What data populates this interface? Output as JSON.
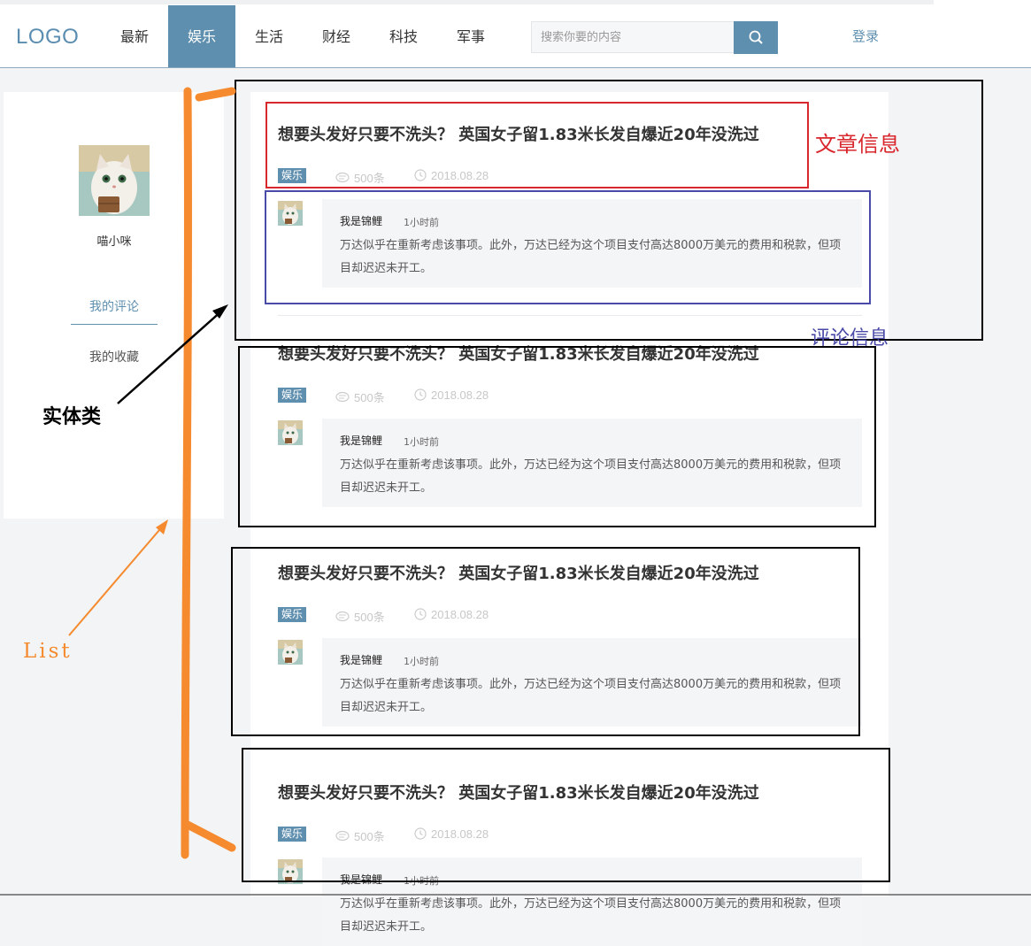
{
  "header": {
    "logo": "LOGO",
    "nav": [
      "最新",
      "娱乐",
      "生活",
      "财经",
      "科技",
      "军事"
    ],
    "active_nav": "娱乐",
    "search_placeholder": "搜索你要的内容",
    "login": "登录"
  },
  "sidebar": {
    "username": "喵小咪",
    "menu": [
      "我的评论",
      "我的收藏"
    ]
  },
  "articles": [
    {
      "title": "想要头发好只要不洗头？ 英国女子留1.83米长发自爆近20年没洗过",
      "tag": "娱乐",
      "views": "500条",
      "date": "2018.08.28",
      "comment": {
        "user": "我是锦鲤",
        "time": "1小时前",
        "text": "万达似乎在重新考虑该事项。此外，万达已经为这个项目支付高达8000万美元的费用和税款，但项目却迟迟未开工。"
      }
    },
    {
      "title": "想要头发好只要不洗头？ 英国女子留1.83米长发自爆近20年没洗过",
      "tag": "娱乐",
      "views": "500条",
      "date": "2018.08.28",
      "comment": {
        "user": "我是锦鲤",
        "time": "1小时前",
        "text": "万达似乎在重新考虑该事项。此外，万达已经为这个项目支付高达8000万美元的费用和税款，但项目却迟迟未开工。"
      }
    },
    {
      "title": "想要头发好只要不洗头？ 英国女子留1.83米长发自爆近20年没洗过",
      "tag": "娱乐",
      "views": "500条",
      "date": "2018.08.28",
      "comment": {
        "user": "我是锦鲤",
        "time": "1小时前",
        "text": "万达似乎在重新考虑该事项。此外，万达已经为这个项目支付高达8000万美元的费用和税款，但项目却迟迟未开工。"
      }
    },
    {
      "title": "想要头发好只要不洗头？ 英国女子留1.83米长发自爆近20年没洗过",
      "tag": "娱乐",
      "views": "500条",
      "date": "2018.08.28",
      "comment": {
        "user": "我是锦鲤",
        "time": "1小时前",
        "text": "万达似乎在重新考虑该事项。此外，万达已经为这个项目支付高达8000万美元的费用和税款，但项目却迟迟未开工。"
      }
    }
  ],
  "annotations": {
    "article_info": "文章信息",
    "comment_info": "评论信息",
    "entity_class": "实体类",
    "list": "List"
  },
  "colors": {
    "accent": "#5f8fae",
    "annotation_red": "#d9272e",
    "annotation_blue": "#4a4aa8",
    "annotation_orange": "#f58a2e",
    "annotation_black": "#000000"
  }
}
